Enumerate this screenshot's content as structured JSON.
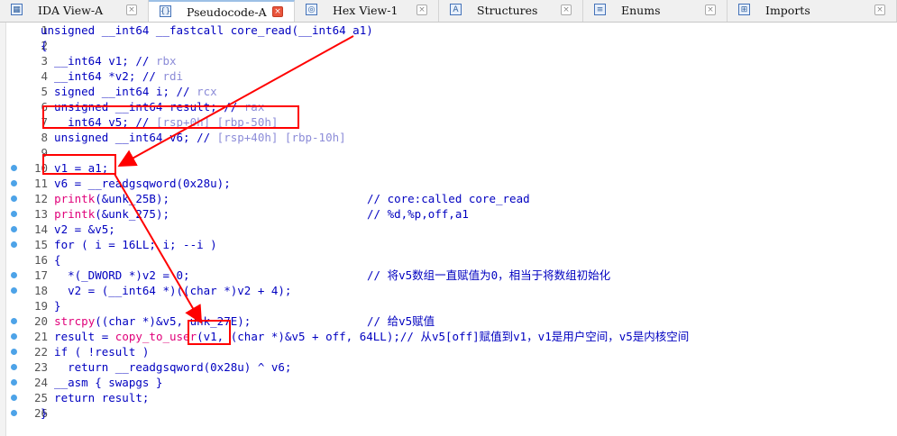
{
  "tabs": [
    {
      "label": "IDA View-A",
      "icon": "ida-view-icon",
      "active": false
    },
    {
      "label": "Pseudocode-A",
      "icon": "pseudocode-icon",
      "active": true
    },
    {
      "label": "Hex View-1",
      "icon": "hex-view-icon",
      "active": false
    },
    {
      "label": "Structures",
      "icon": "structures-icon",
      "active": false
    },
    {
      "label": "Enums",
      "icon": "enums-icon",
      "active": false
    },
    {
      "label": "Imports",
      "icon": "imports-icon",
      "active": false
    }
  ],
  "lines": [
    {
      "n": "1",
      "dot": false,
      "code": "unsigned __int64 __fastcall core_read(__int64 a1)"
    },
    {
      "n": "2",
      "dot": false,
      "code": "{"
    },
    {
      "n": "3",
      "dot": false,
      "code": "  __int64 v1; // rbx"
    },
    {
      "n": "4",
      "dot": false,
      "code": "  __int64 *v2; // rdi"
    },
    {
      "n": "5",
      "dot": false,
      "code": "  signed __int64 i; // rcx"
    },
    {
      "n": "6",
      "dot": false,
      "code": "  unsigned __int64 result; // rax"
    },
    {
      "n": "7",
      "dot": false,
      "code": "  __int64 v5; // [rsp+0h] [rbp-50h]"
    },
    {
      "n": "8",
      "dot": false,
      "code": "  unsigned __int64 v6; // [rsp+40h] [rbp-10h]"
    },
    {
      "n": "9",
      "dot": false,
      "code": ""
    },
    {
      "n": "10",
      "dot": true,
      "code": "  v1 = a1;"
    },
    {
      "n": "11",
      "dot": true,
      "code": "  v6 = __readgsqword(0x28u);"
    },
    {
      "n": "12",
      "dot": true,
      "code": "  printk(&unk_25B);",
      "comment": "// core:called core_read"
    },
    {
      "n": "13",
      "dot": true,
      "code": "  printk(&unk_275);",
      "comment": "// %d,%p,off,a1"
    },
    {
      "n": "14",
      "dot": true,
      "code": "  v2 = &v5;"
    },
    {
      "n": "15",
      "dot": true,
      "code": "  for ( i = 16LL; i; --i )"
    },
    {
      "n": "16",
      "dot": false,
      "code": "  {"
    },
    {
      "n": "17",
      "dot": true,
      "code": "    *(_DWORD *)v2 = 0;",
      "comment": "// 将v5数组一直赋值为0，相当于将数组初始化"
    },
    {
      "n": "18",
      "dot": true,
      "code": "    v2 = (__int64 *)((char *)v2 + 4);"
    },
    {
      "n": "19",
      "dot": false,
      "code": "  }"
    },
    {
      "n": "20",
      "dot": true,
      "code": "  strcpy((char *)&v5, unk_27E);",
      "comment": "// 给v5赋值"
    },
    {
      "n": "21",
      "dot": true,
      "code": "  result = copy_to_user(v1, (char *)&v5 + off, 64LL);// 从v5[off]赋值到v1，v1是用户空间，v5是内核空间"
    },
    {
      "n": "22",
      "dot": true,
      "code": "  if ( !result )"
    },
    {
      "n": "23",
      "dot": true,
      "code": "    return __readgsqword(0x28u) ^ v6;"
    },
    {
      "n": "24",
      "dot": true,
      "code": "  __asm { swapgs }"
    },
    {
      "n": "25",
      "dot": true,
      "code": "  return result;"
    },
    {
      "n": "26",
      "dot": true,
      "code": "}"
    }
  ],
  "colors": {
    "keyword": "#0000c0",
    "comment_var": "#8c8cd8",
    "func": "#e0007a",
    "annotation": "#ff0000",
    "breakpoint_dot": "#4da3e8"
  }
}
